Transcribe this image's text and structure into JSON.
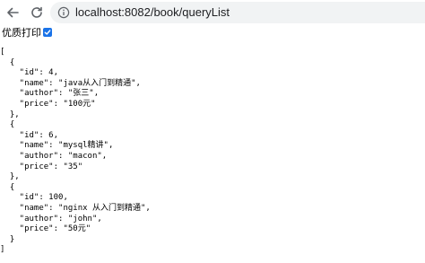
{
  "browser": {
    "url": "localhost:8082/book/queryList"
  },
  "pretty_print": {
    "label": "优质打印",
    "checked": true
  },
  "json_lines": [
    "[",
    "  {",
    "    \"id\": 4,",
    "    \"name\": \"java从入门到精通\",",
    "    \"author\": \"张三\",",
    "    \"price\": \"100元\"",
    "  },",
    "  {",
    "    \"id\": 6,",
    "    \"name\": \"mysql精讲\",",
    "    \"author\": \"macon\",",
    "    \"price\": \"35\"",
    "  },",
    "  {",
    "    \"id\": 100,",
    "    \"name\": \"nginx 从入门到精通\",",
    "    \"author\": \"john\",",
    "    \"price\": \"50元\"",
    "  }",
    "]"
  ]
}
